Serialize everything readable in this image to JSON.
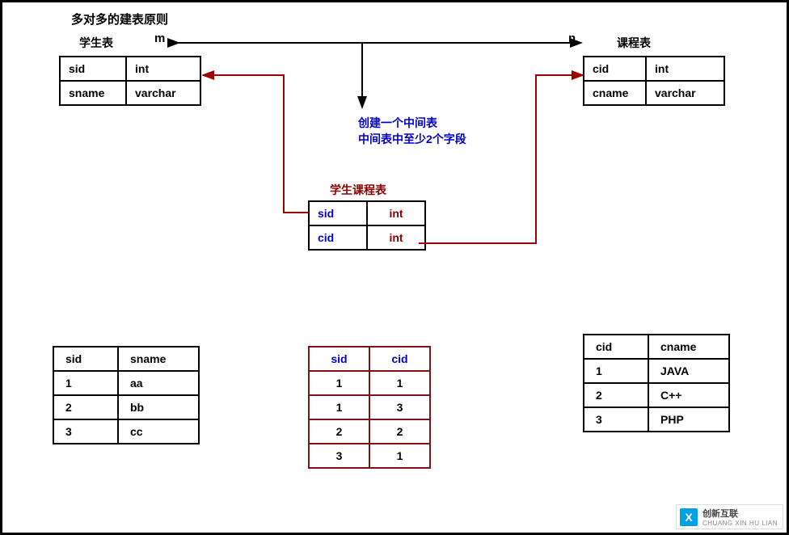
{
  "title": "多对多的建表原则",
  "labels": {
    "student_table": "学生表",
    "course_table": "课程表",
    "junction_table": "学生课程表",
    "m": "m",
    "n": "n"
  },
  "note_line1": "创建一个中间表",
  "note_line2": "中间表中至少2个字段",
  "student_schema": {
    "rows": [
      {
        "col1": "sid",
        "col2": "int"
      },
      {
        "col1": "sname",
        "col2": "varchar"
      }
    ]
  },
  "course_schema": {
    "rows": [
      {
        "col1": "cid",
        "col2": "int"
      },
      {
        "col1": "cname",
        "col2": "varchar"
      }
    ]
  },
  "junction_schema": {
    "rows": [
      {
        "col1": "sid",
        "col2": "int"
      },
      {
        "col1": "cid",
        "col2": "int"
      }
    ]
  },
  "student_data": {
    "headers": {
      "h1": "sid",
      "h2": "sname"
    },
    "rows": [
      {
        "c1": "1",
        "c2": "aa"
      },
      {
        "c1": "2",
        "c2": "bb"
      },
      {
        "c1": "3",
        "c2": "cc"
      }
    ]
  },
  "junction_data": {
    "headers": {
      "h1": "sid",
      "h2": "cid"
    },
    "rows": [
      {
        "c1": "1",
        "c2": "1"
      },
      {
        "c1": "1",
        "c2": "3"
      },
      {
        "c1": "2",
        "c2": "2"
      },
      {
        "c1": "3",
        "c2": "1"
      }
    ]
  },
  "course_data": {
    "headers": {
      "h1": "cid",
      "h2": "cname"
    },
    "rows": [
      {
        "c1": "1",
        "c2": "JAVA"
      },
      {
        "c1": "2",
        "c2": "C++"
      },
      {
        "c1": "3",
        "c2": "PHP"
      }
    ]
  },
  "watermark": {
    "brand_cn": "创新互联",
    "brand_en": "CHUANG XIN HU LIAN",
    "icon_letter": "X"
  },
  "chart_data": {
    "type": "table",
    "description": "Entity-relationship diagram showing a many-to-many (m:n) relationship between a Student table and a Course table via a junction table (Student-Course).",
    "entities": [
      {
        "name": "学生表",
        "columns": [
          {
            "name": "sid",
            "type": "int"
          },
          {
            "name": "sname",
            "type": "varchar"
          }
        ],
        "sample_rows": [
          {
            "sid": 1,
            "sname": "aa"
          },
          {
            "sid": 2,
            "sname": "bb"
          },
          {
            "sid": 3,
            "sname": "cc"
          }
        ]
      },
      {
        "name": "课程表",
        "columns": [
          {
            "name": "cid",
            "type": "int"
          },
          {
            "name": "cname",
            "type": "varchar"
          }
        ],
        "sample_rows": [
          {
            "cid": 1,
            "cname": "JAVA"
          },
          {
            "cid": 2,
            "cname": "C++"
          },
          {
            "cid": 3,
            "cname": "PHP"
          }
        ]
      },
      {
        "name": "学生课程表",
        "columns": [
          {
            "name": "sid",
            "type": "int"
          },
          {
            "name": "cid",
            "type": "int"
          }
        ],
        "sample_rows": [
          {
            "sid": 1,
            "cid": 1
          },
          {
            "sid": 1,
            "cid": 3
          },
          {
            "sid": 2,
            "cid": 2
          },
          {
            "sid": 3,
            "cid": 1
          }
        ]
      }
    ],
    "relationship": {
      "left": "学生表",
      "right": "课程表",
      "via": "学生课程表",
      "left_cardinality": "m",
      "right_cardinality": "n"
    }
  }
}
